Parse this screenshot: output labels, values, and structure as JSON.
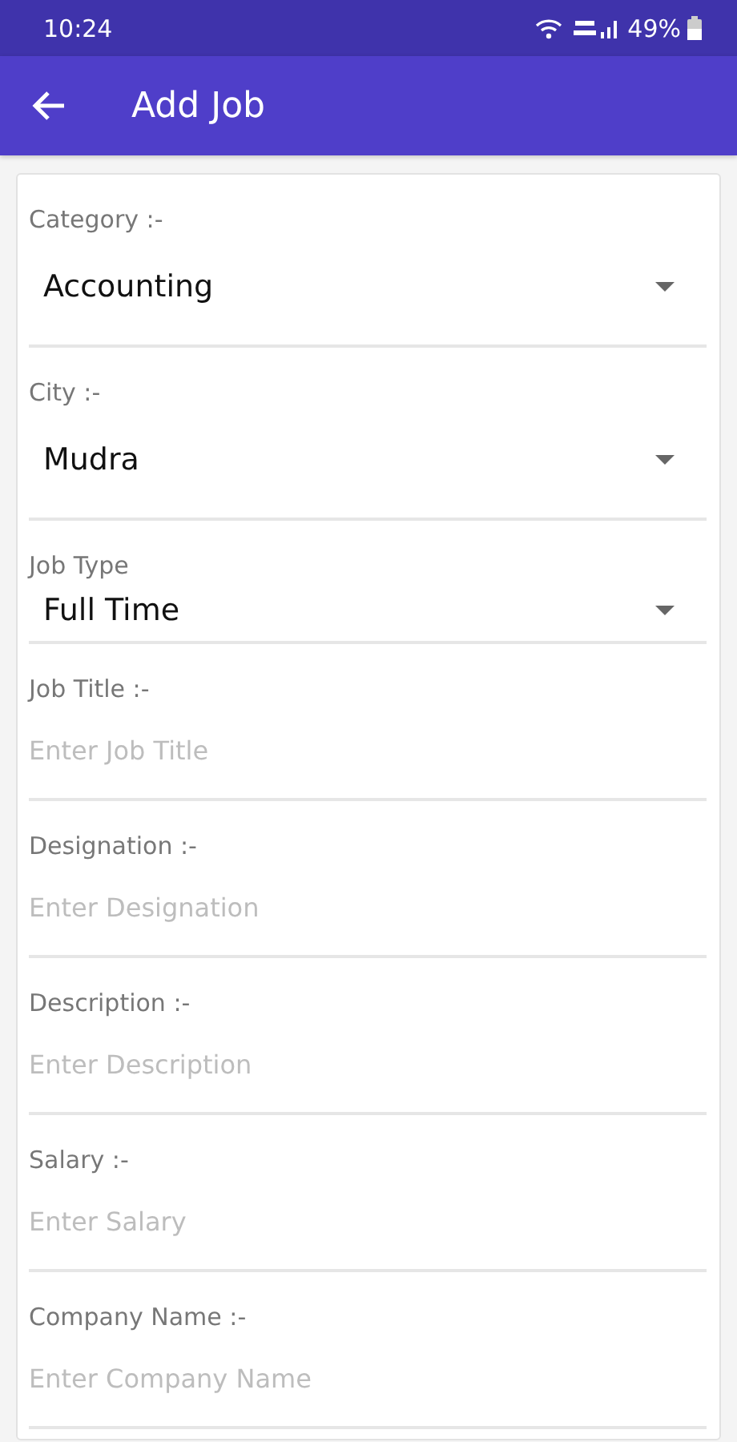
{
  "status_bar": {
    "time": "10:24",
    "battery": "49%"
  },
  "app_bar": {
    "title": "Add Job"
  },
  "fields": [
    {
      "kind": "dropdown",
      "label": "Category :-",
      "value": "Accounting"
    },
    {
      "kind": "dropdown",
      "label": "City :-",
      "value": "Mudra"
    },
    {
      "kind": "dropdown_compact",
      "label": "Job Type",
      "value": "Full Time"
    },
    {
      "kind": "text",
      "label": "Job Title :-",
      "placeholder": "Enter Job Title"
    },
    {
      "kind": "text",
      "label": "Designation :-",
      "placeholder": "Enter Designation"
    },
    {
      "kind": "text",
      "label": "Description :-",
      "placeholder": "Enter Description"
    },
    {
      "kind": "text",
      "label": "Salary :-",
      "placeholder": "Enter Salary"
    },
    {
      "kind": "text",
      "label": "Company Name :-",
      "placeholder": "Enter Company Name"
    }
  ]
}
